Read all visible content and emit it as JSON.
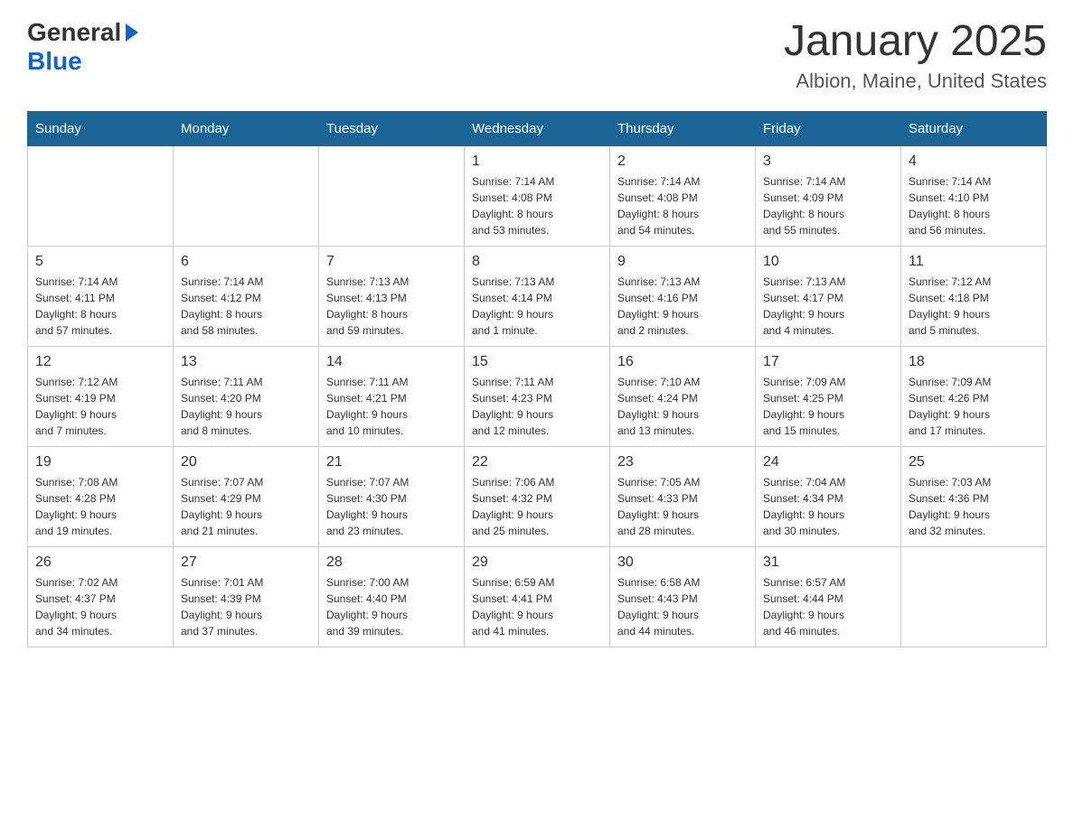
{
  "header": {
    "logo_general": "General",
    "logo_blue": "Blue",
    "title": "January 2025",
    "subtitle": "Albion, Maine, United States"
  },
  "days_of_week": [
    "Sunday",
    "Monday",
    "Tuesday",
    "Wednesday",
    "Thursday",
    "Friday",
    "Saturday"
  ],
  "weeks": [
    [
      {
        "day": "",
        "info": ""
      },
      {
        "day": "",
        "info": ""
      },
      {
        "day": "",
        "info": ""
      },
      {
        "day": "1",
        "info": "Sunrise: 7:14 AM\nSunset: 4:08 PM\nDaylight: 8 hours\nand 53 minutes."
      },
      {
        "day": "2",
        "info": "Sunrise: 7:14 AM\nSunset: 4:08 PM\nDaylight: 8 hours\nand 54 minutes."
      },
      {
        "day": "3",
        "info": "Sunrise: 7:14 AM\nSunset: 4:09 PM\nDaylight: 8 hours\nand 55 minutes."
      },
      {
        "day": "4",
        "info": "Sunrise: 7:14 AM\nSunset: 4:10 PM\nDaylight: 8 hours\nand 56 minutes."
      }
    ],
    [
      {
        "day": "5",
        "info": "Sunrise: 7:14 AM\nSunset: 4:11 PM\nDaylight: 8 hours\nand 57 minutes."
      },
      {
        "day": "6",
        "info": "Sunrise: 7:14 AM\nSunset: 4:12 PM\nDaylight: 8 hours\nand 58 minutes."
      },
      {
        "day": "7",
        "info": "Sunrise: 7:13 AM\nSunset: 4:13 PM\nDaylight: 8 hours\nand 59 minutes."
      },
      {
        "day": "8",
        "info": "Sunrise: 7:13 AM\nSunset: 4:14 PM\nDaylight: 9 hours\nand 1 minute."
      },
      {
        "day": "9",
        "info": "Sunrise: 7:13 AM\nSunset: 4:16 PM\nDaylight: 9 hours\nand 2 minutes."
      },
      {
        "day": "10",
        "info": "Sunrise: 7:13 AM\nSunset: 4:17 PM\nDaylight: 9 hours\nand 4 minutes."
      },
      {
        "day": "11",
        "info": "Sunrise: 7:12 AM\nSunset: 4:18 PM\nDaylight: 9 hours\nand 5 minutes."
      }
    ],
    [
      {
        "day": "12",
        "info": "Sunrise: 7:12 AM\nSunset: 4:19 PM\nDaylight: 9 hours\nand 7 minutes."
      },
      {
        "day": "13",
        "info": "Sunrise: 7:11 AM\nSunset: 4:20 PM\nDaylight: 9 hours\nand 8 minutes."
      },
      {
        "day": "14",
        "info": "Sunrise: 7:11 AM\nSunset: 4:21 PM\nDaylight: 9 hours\nand 10 minutes."
      },
      {
        "day": "15",
        "info": "Sunrise: 7:11 AM\nSunset: 4:23 PM\nDaylight: 9 hours\nand 12 minutes."
      },
      {
        "day": "16",
        "info": "Sunrise: 7:10 AM\nSunset: 4:24 PM\nDaylight: 9 hours\nand 13 minutes."
      },
      {
        "day": "17",
        "info": "Sunrise: 7:09 AM\nSunset: 4:25 PM\nDaylight: 9 hours\nand 15 minutes."
      },
      {
        "day": "18",
        "info": "Sunrise: 7:09 AM\nSunset: 4:26 PM\nDaylight: 9 hours\nand 17 minutes."
      }
    ],
    [
      {
        "day": "19",
        "info": "Sunrise: 7:08 AM\nSunset: 4:28 PM\nDaylight: 9 hours\nand 19 minutes."
      },
      {
        "day": "20",
        "info": "Sunrise: 7:07 AM\nSunset: 4:29 PM\nDaylight: 9 hours\nand 21 minutes."
      },
      {
        "day": "21",
        "info": "Sunrise: 7:07 AM\nSunset: 4:30 PM\nDaylight: 9 hours\nand 23 minutes."
      },
      {
        "day": "22",
        "info": "Sunrise: 7:06 AM\nSunset: 4:32 PM\nDaylight: 9 hours\nand 25 minutes."
      },
      {
        "day": "23",
        "info": "Sunrise: 7:05 AM\nSunset: 4:33 PM\nDaylight: 9 hours\nand 28 minutes."
      },
      {
        "day": "24",
        "info": "Sunrise: 7:04 AM\nSunset: 4:34 PM\nDaylight: 9 hours\nand 30 minutes."
      },
      {
        "day": "25",
        "info": "Sunrise: 7:03 AM\nSunset: 4:36 PM\nDaylight: 9 hours\nand 32 minutes."
      }
    ],
    [
      {
        "day": "26",
        "info": "Sunrise: 7:02 AM\nSunset: 4:37 PM\nDaylight: 9 hours\nand 34 minutes."
      },
      {
        "day": "27",
        "info": "Sunrise: 7:01 AM\nSunset: 4:39 PM\nDaylight: 9 hours\nand 37 minutes."
      },
      {
        "day": "28",
        "info": "Sunrise: 7:00 AM\nSunset: 4:40 PM\nDaylight: 9 hours\nand 39 minutes."
      },
      {
        "day": "29",
        "info": "Sunrise: 6:59 AM\nSunset: 4:41 PM\nDaylight: 9 hours\nand 41 minutes."
      },
      {
        "day": "30",
        "info": "Sunrise: 6:58 AM\nSunset: 4:43 PM\nDaylight: 9 hours\nand 44 minutes."
      },
      {
        "day": "31",
        "info": "Sunrise: 6:57 AM\nSunset: 4:44 PM\nDaylight: 9 hours\nand 46 minutes."
      },
      {
        "day": "",
        "info": ""
      }
    ]
  ]
}
